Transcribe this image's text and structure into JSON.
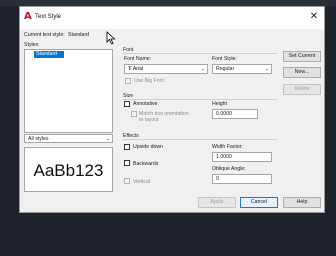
{
  "dialog": {
    "title": "Text Style",
    "close_glyph": "✕"
  },
  "current_style": {
    "label": "Current text style:",
    "value": "Standard"
  },
  "styles": {
    "label": "Styles:",
    "items": [
      "Standard"
    ],
    "filter_value": "All styles"
  },
  "font": {
    "group_label": "Font",
    "name_label": "Font Name:",
    "name_value": "Arial",
    "name_icon": "truetype-icon",
    "style_label": "Font Style:",
    "style_value": "Regular",
    "big_font_label": "Use Big Font"
  },
  "size": {
    "group_label": "Size",
    "annotative_label": "Annotative",
    "match_orientation_label_1": "Match text orientation",
    "match_orientation_label_2": "to layout",
    "height_label": "Height",
    "height_value": "0.0000"
  },
  "effects": {
    "group_label": "Effects",
    "upside_down_label": "Upside down",
    "backwards_label": "Backwards",
    "vertical_label": "Vertical",
    "width_factor_label": "Width Factor:",
    "width_factor_value": "1.0000",
    "oblique_label": "Oblique Angle:",
    "oblique_value": "0"
  },
  "preview": {
    "text": "AaBb123"
  },
  "buttons": {
    "set_current": "Set Current",
    "new": "New...",
    "delete": "Delete",
    "apply": "Apply",
    "cancel": "Cancel",
    "help": "Help"
  },
  "colors": {
    "selection": "#0078d7",
    "accent_icon": "#c8102e"
  }
}
